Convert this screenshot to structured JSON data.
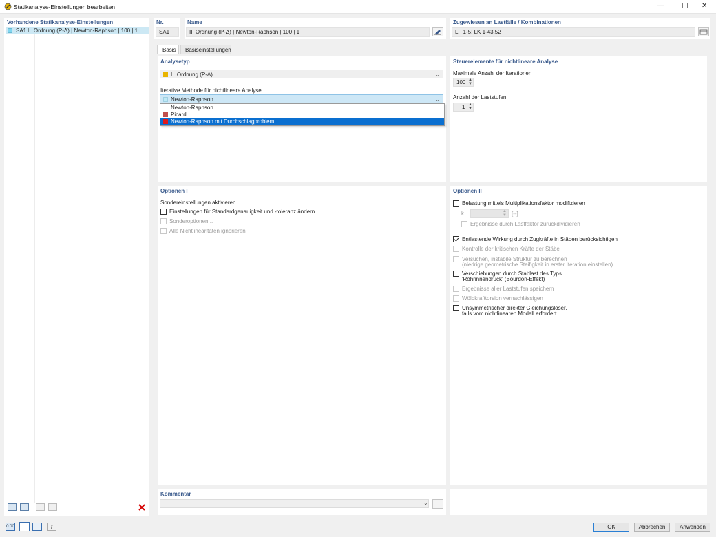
{
  "window": {
    "title": "Statikanalyse-Einstellungen bearbeiten",
    "minimize": "—",
    "maximize": "☐",
    "close": "✕"
  },
  "left": {
    "title": "Vorhandene Statikanalyse-Einstellungen",
    "items": [
      {
        "id": "SA1",
        "label": "II. Ordnung (P-Δ) | Newton-Raphson | 100 | 1",
        "color": "#7fd6f0"
      }
    ]
  },
  "header": {
    "nr_label": "Nr.",
    "nr_value": "SA1",
    "name_label": "Name",
    "name_value": "II. Ordnung (P-Δ) | Newton-Raphson | 100 | 1",
    "assigned_label": "Zugewiesen an Lastfälle / Kombinationen",
    "assigned_value": "LF 1-5; LK 1-43,52"
  },
  "tabs": [
    {
      "label": "Basis",
      "active": true
    },
    {
      "label": "Basiseinstellungen",
      "active": false
    }
  ],
  "analysis": {
    "title": "Analysetyp",
    "type_value": "II. Ordnung (P-Δ)",
    "type_color": "#e8b400",
    "method_label": "Iterative Methode für nichtlineare Analyse",
    "method_value": "Newton-Raphson",
    "method_color": "#bfe9f6",
    "options": [
      {
        "label": "Newton-Raphson",
        "color": "",
        "selected": false
      },
      {
        "label": "Picard",
        "color": "#c0504d",
        "selected": false
      },
      {
        "label": "Newton-Raphson mit Durchschlagproblem",
        "color": "#e0191b",
        "selected": true
      }
    ]
  },
  "controls": {
    "title": "Steuerelemente für nichtlineare Analyse",
    "max_iter_label": "Maximale Anzahl der Iterationen",
    "max_iter_value": "100",
    "load_steps_label": "Anzahl der Laststufen",
    "load_steps_value": "1"
  },
  "options1": {
    "title": "Optionen I",
    "subtitle": "Sondereinstellungen aktivieren",
    "items": [
      {
        "label": "Einstellungen für Standardgenauigkeit und -toleranz ändern...",
        "checked": false,
        "disabled": false
      },
      {
        "label": "Sonderoptionen...",
        "checked": false,
        "disabled": true
      },
      {
        "label": "Alle Nichtlinearitäten ignorieren",
        "checked": false,
        "disabled": true
      }
    ]
  },
  "options2": {
    "title": "Optionen II",
    "multiplier": {
      "label": "Belastung mittels Multiplikationsfaktor modifizieren",
      "checked": false
    },
    "k_label": "k",
    "k_unit": "[--]",
    "divide": {
      "label": "Ergebnisse durch Lastfaktor zurückdividieren",
      "checked": false
    },
    "items": [
      {
        "label": "Entlastende Wirkung durch Zugkräfte in Stäben berücksichtigen",
        "label2": "",
        "checked": true,
        "disabled": false
      },
      {
        "label": "Kontrolle der kritischen Kräfte der Stäbe",
        "label2": "",
        "checked": false,
        "disabled": true
      },
      {
        "label": "Versuchen, instabile Struktur zu berechnen",
        "label2": "(niedrige geometrische Steifigkeit in erster Iteration einstellen)",
        "checked": false,
        "disabled": true
      },
      {
        "label": "Verschiebungen durch Stablast des Typs",
        "label2": "'Rohrinnendruck' (Bourdon-Effekt)",
        "checked": false,
        "disabled": false
      },
      {
        "label": "Ergebnisse aller Laststufen speichern",
        "label2": "",
        "checked": false,
        "disabled": true
      },
      {
        "label": "Wölbkrafttorsion vernachlässigen",
        "label2": "",
        "checked": false,
        "disabled": true
      },
      {
        "label": "Unsymmetrischer direkter Gleichungslöser,",
        "label2": "falls vom nichtlinearen Modell erfordert",
        "checked": false,
        "disabled": false
      }
    ]
  },
  "comment": {
    "title": "Kommentar",
    "value": ""
  },
  "footer": {
    "ok": "OK",
    "cancel": "Abbrechen",
    "apply": "Anwenden"
  },
  "icons": {
    "app": "app-logo-icon",
    "delete": "delete-icon"
  }
}
